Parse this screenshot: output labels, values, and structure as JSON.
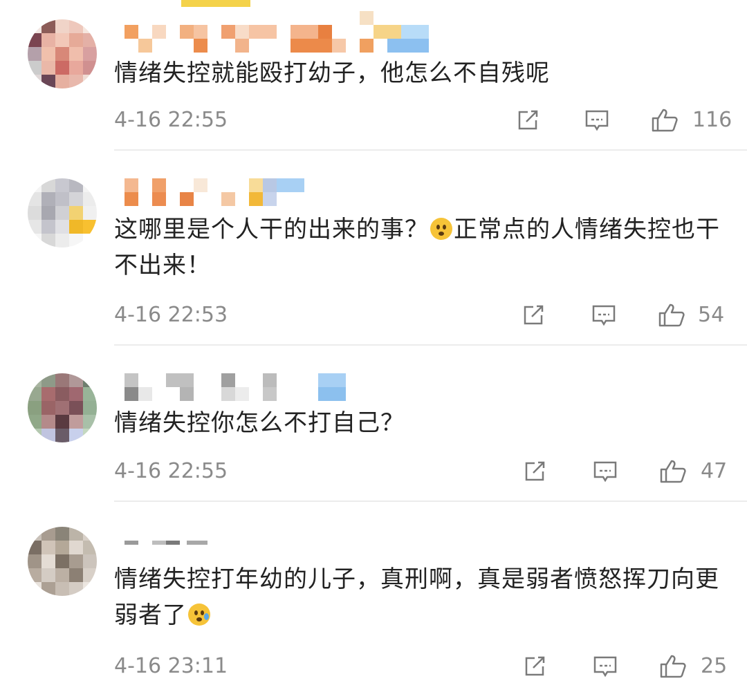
{
  "comments": [
    {
      "text": "情绪失控就能殴打幼子，他怎么不自残呢",
      "time": "4-16 22:55",
      "likes": "116",
      "emoji": "",
      "text_after": ""
    },
    {
      "text": "这哪里是个人干的出来的事？",
      "time": "4-16 22:53",
      "likes": "54",
      "emoji": "surprised-face",
      "text_after": "正常点的人情绪失控也干不出来！"
    },
    {
      "text": "情绪失控你怎么不打自己？",
      "time": "4-16 22:55",
      "likes": "47",
      "emoji": "",
      "text_after": ""
    },
    {
      "text": "情绪失控打年幼的儿子，真刑啊，真是弱者愤怒挥刀向更弱者了",
      "time": "4-16 23:11",
      "likes": "25",
      "emoji": "sad-sweat-face",
      "text_after": ""
    }
  ],
  "icons": {
    "share": "share-icon",
    "reply": "comment-icon",
    "like": "thumbs-up-icon"
  },
  "colors": {
    "text": "#222222",
    "meta": "#8a8a8a",
    "divider": "#ececec"
  }
}
